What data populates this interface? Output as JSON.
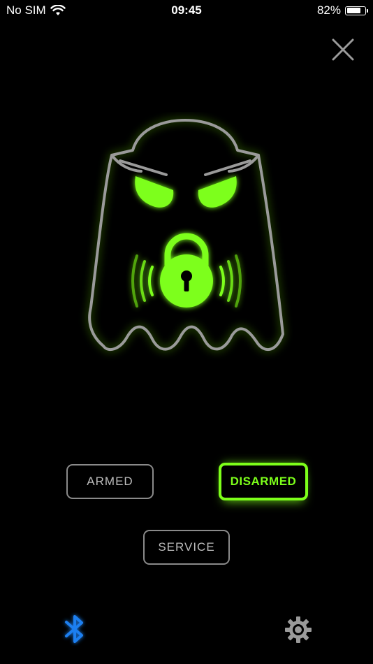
{
  "status_bar": {
    "carrier": "No SIM",
    "time": "09:45",
    "battery_percent": "82%",
    "battery_level": 0.82
  },
  "icons": {
    "wifi": "wifi-icon",
    "battery": "battery-icon",
    "close": "close-icon",
    "ghost": "ghost-lock-icon",
    "bluetooth": "bluetooth-icon",
    "settings": "gear-icon"
  },
  "modes": {
    "armed_label": "ARMED",
    "disarmed_label": "DISARMED",
    "service_label": "SERVICE",
    "active": "DISARMED"
  },
  "colors": {
    "accent_green": "#7dff1a",
    "outline_gray": "#8a8a8a",
    "bluetooth_blue": "#1e7ff0",
    "background": "#000000"
  }
}
